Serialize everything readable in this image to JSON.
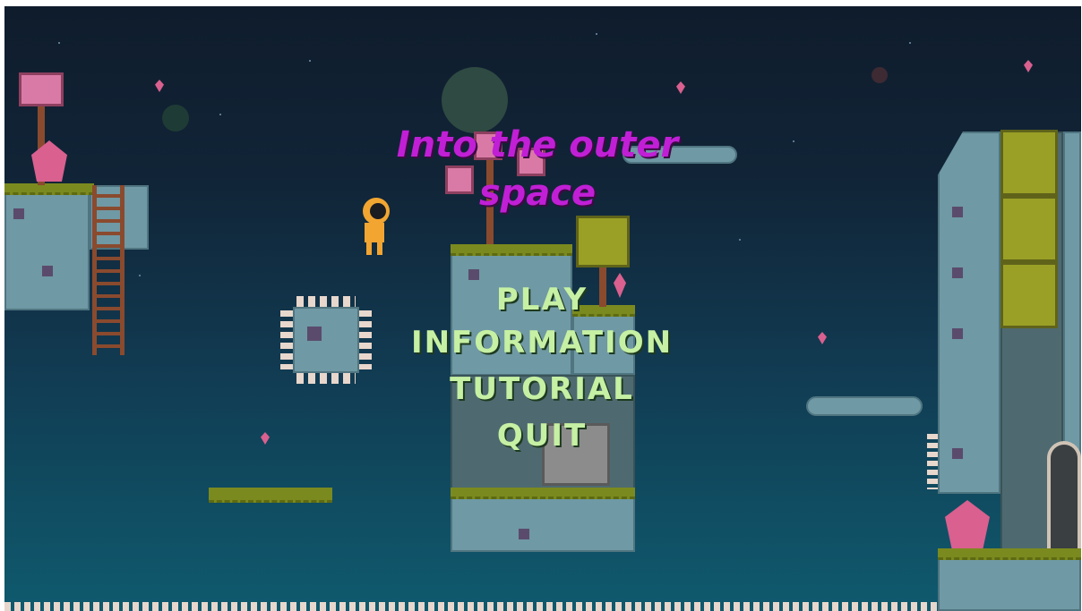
{
  "game": {
    "title": "Into the outer space",
    "menu": {
      "play": "PLAY",
      "information": "INFORMATION",
      "tutorial": "TUTORIAL",
      "quit": "QUIT"
    }
  },
  "colors": {
    "title": "#c11fd6",
    "menu_text": "#c6f0a3",
    "sky_top": "#0f1c2c",
    "sky_bottom": "#0f5a6e",
    "stone": "#6f99a4",
    "moss": "#7b8a1e"
  }
}
